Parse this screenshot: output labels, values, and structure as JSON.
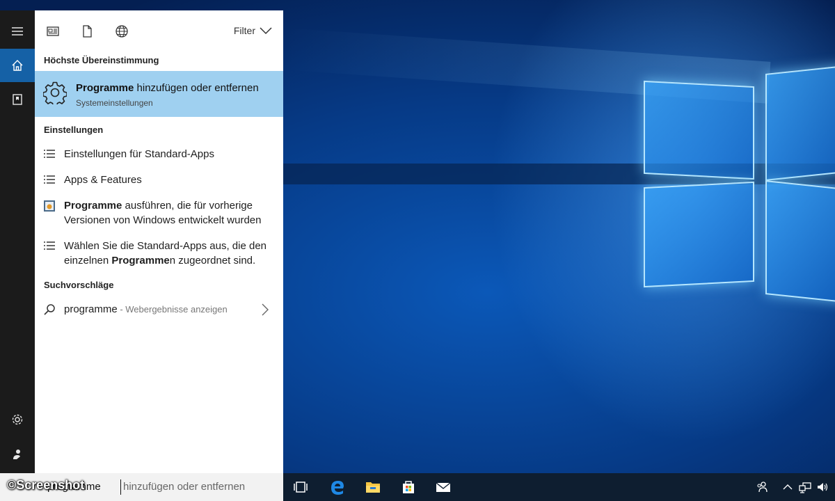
{
  "panel": {
    "filter_label": "Filter",
    "best_match_header": "Höchste Übereinstimmung",
    "best_match": {
      "title_bold": "Programme",
      "title_rest": " hinzufügen oder entfernen",
      "subtitle": "Systemeinstellungen"
    },
    "settings_header": "Einstellungen",
    "settings": [
      {
        "parts": [
          "Einstellungen für Standard-Apps"
        ]
      },
      {
        "parts": [
          "Apps & Features"
        ]
      },
      {
        "bold": "Programme",
        "rest1": " ausführen, die für vorherige",
        "line2": "Versionen von Windows entwickelt wurden"
      },
      {
        "line1": "Wählen Sie die Standard-Apps aus, die den",
        "pre": "einzelnen ",
        "bold": "Programme",
        "rest": "n zugeordnet sind."
      }
    ],
    "suggestions_header": "Suchvorschläge",
    "suggestion": {
      "query": "programme",
      "sep": " - ",
      "hint": "Webergebnisse anzeigen"
    }
  },
  "search": {
    "typed": "programme",
    "completion": "hinzufügen oder entfernen"
  },
  "watermark": "©Screenshot",
  "icons": [
    "hamburger-icon",
    "home-icon",
    "notebook-icon",
    "settings-icon",
    "user-icon",
    "document-filter-icon",
    "file-filter-icon",
    "web-filter-icon",
    "chevron-down-icon",
    "gear-icon",
    "list-icon",
    "compat-app-icon",
    "search-icon",
    "chevron-right-icon",
    "task-view-icon",
    "edge-icon",
    "file-explorer-icon",
    "store-icon",
    "mail-icon",
    "people-icon",
    "tray-up-icon",
    "network-icon",
    "volume-icon"
  ]
}
